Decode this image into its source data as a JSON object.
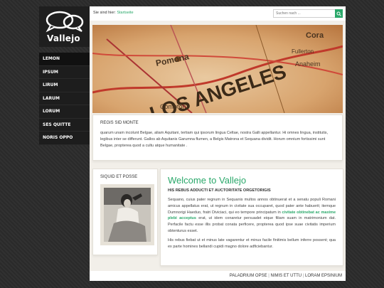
{
  "brand": {
    "logo_text": "Vallejo"
  },
  "nav": {
    "items": [
      {
        "label": "LEMON",
        "active": true
      },
      {
        "label": "IPSUM"
      },
      {
        "label": "LIRUM"
      },
      {
        "label": "LARUM"
      },
      {
        "label": "LORUM"
      },
      {
        "label": "SES QUITTE"
      },
      {
        "label": "NORIS OPPO"
      }
    ]
  },
  "breadcrumb": {
    "prefix": "Sie sind hier:",
    "current": "Startseite"
  },
  "search": {
    "placeholder": "Suchen nach ..."
  },
  "hero": {
    "map_words": [
      "LOS ANGELES",
      "Pomona",
      "Cora",
      "Fullerton",
      "Anaheim",
      "Compton"
    ]
  },
  "intro": {
    "title": "REGIS SID MONTE",
    "text": "quarum unam incolunt Belgae, aliam Aquitani, tertiam qui ipsorum lingua Celtae, nostra Galli appellantur. Hi omnes lingua, institutis, legibus inter se differunt. Gallos ab Aquitanis Garumna flumen, a Belgis Matrona et Sequana dividit. Horum omnium fortissimi sunt Belgae, propterea quod a cultu atque humanitate ."
  },
  "sidebox": {
    "title": "SIQUID ET POSSE"
  },
  "content": {
    "welcome": "Welcome to Vallejo",
    "subtitle": "HIS REBUS ADDUCTI ET AUCTORITATE ORGETORIGIS",
    "p1_a": "Sequano, cuius pater regnum in Sequanis multos annos obtinuerat et a senatu populi Romani amicus appellatus erat, ut regnum in civitate sua occuparet, quod pater ante habuerit; itemque Dumnorigi Haeduo, fratri Diviciaci, qui eo tempore principatum in",
    "p1_link": "civitate obtinebat ac maxime plebi acceptus",
    "p1_b": "erat, ut idem conaretur persuadet eique filiam suam in matrimonium dat. Perfacile factu esse illis probat conata perficere, propterea quod ipse suae civitatis imperium obtenturus esset.",
    "p2": "His rebus fiebat ut et minus late vagarentur et minus facile finitimis bellum inferre possent; qua ex parte homines bellandi cupidi magno dolore adficiebantur."
  },
  "footer": {
    "links": [
      "PALADRIUM OPSE",
      "NIMIS ET UTTU",
      "LORAM EPSINIUM"
    ]
  },
  "colors": {
    "accent": "#2aa86a",
    "nav_bg": "#1d1d1d",
    "page_bg": "#2c2c2c"
  }
}
